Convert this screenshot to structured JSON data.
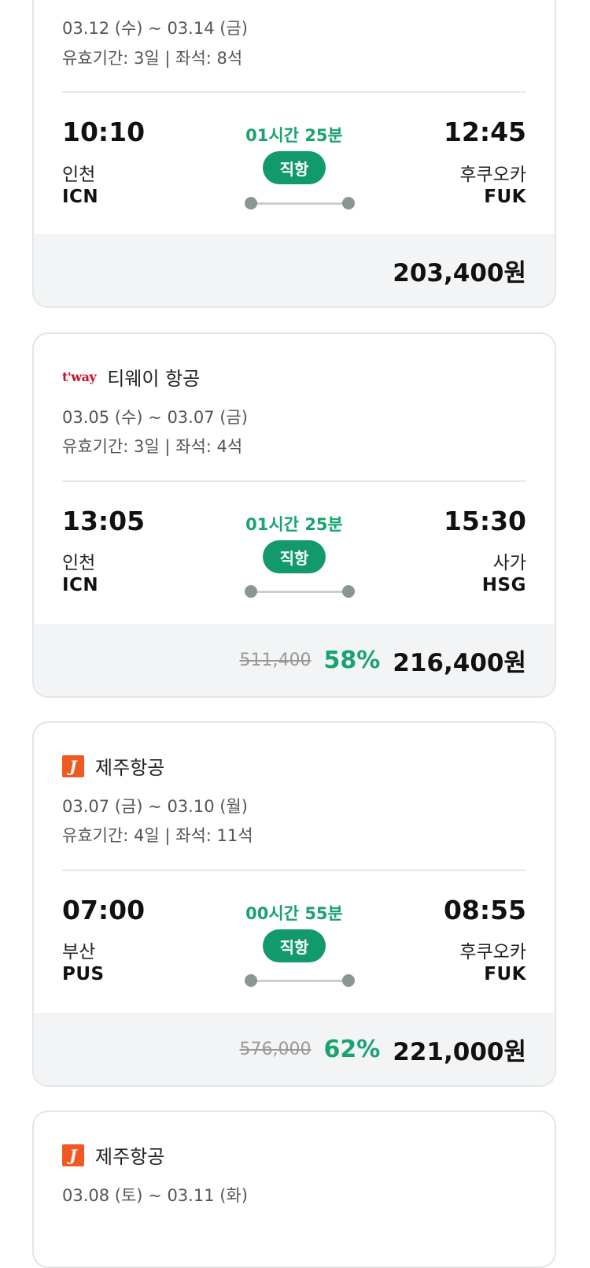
{
  "cards": [
    {
      "dates": "03.12 (수) ~ 03.14 (금)",
      "meta": "유효기간: 3일 | 좌석: 8석",
      "dep_time": "10:10",
      "dep_city": "인천",
      "dep_code": "ICN",
      "arr_time": "12:45",
      "arr_city": "후쿠오카",
      "arr_code": "FUK",
      "duration": "01시간 25분",
      "badge": "직항",
      "final_price": "203,400원"
    },
    {
      "airline": "티웨이 항공",
      "logo_text": "t'way",
      "dates": "03.05 (수) ~ 03.07 (금)",
      "meta": "유효기간: 3일 | 좌석: 4석",
      "dep_time": "13:05",
      "dep_city": "인천",
      "dep_code": "ICN",
      "arr_time": "15:30",
      "arr_city": "사가",
      "arr_code": "HSG",
      "duration": "01시간 25분",
      "badge": "직항",
      "original_price": "511,400",
      "discount": "58%",
      "final_price": "216,400원"
    },
    {
      "airline": "제주항공",
      "logo_text": "J",
      "dates": "03.07 (금) ~ 03.10 (월)",
      "meta": "유효기간: 4일 | 좌석: 11석",
      "dep_time": "07:00",
      "dep_city": "부산",
      "dep_code": "PUS",
      "arr_time": "08:55",
      "arr_city": "후쿠오카",
      "arr_code": "FUK",
      "duration": "00시간 55분",
      "badge": "직항",
      "original_price": "576,000",
      "discount": "62%",
      "final_price": "221,000원"
    },
    {
      "airline": "제주항공",
      "logo_text": "J",
      "dates": "03.08 (토) ~ 03.11 (화)"
    }
  ],
  "colors": {
    "accent": "#129a6b",
    "duration_text": "#19a36e",
    "tway_red": "#c8102e",
    "jeju_orange": "#ef5a22"
  }
}
